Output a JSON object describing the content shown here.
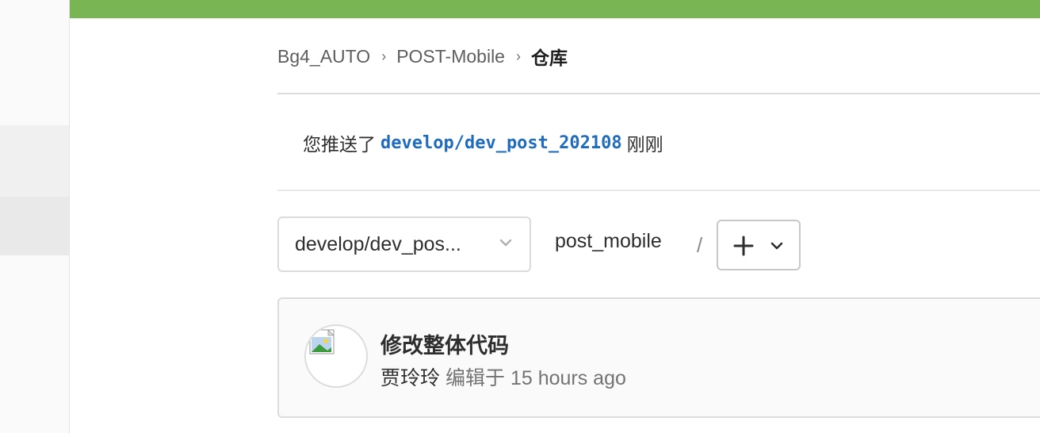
{
  "breadcrumb": {
    "group": "Bg4_AUTO",
    "project": "POST-Mobile",
    "current": "仓库"
  },
  "push_notice": {
    "prefix": "您推送了",
    "branch": "develop/dev_post_202108",
    "suffix": "刚刚"
  },
  "repo_nav": {
    "branch_selector": "develop/dev_pos...",
    "repo_path": "post_mobile",
    "path_separator": "/",
    "add_menu_icon": "plus-icon"
  },
  "last_commit": {
    "title": "修改整体代码",
    "author": "贾玲玲",
    "edited_label": "编辑于",
    "time_ago": "15 hours ago"
  },
  "colors": {
    "top_bar": "#7ab554",
    "branch_link": "#1f6cbf"
  }
}
